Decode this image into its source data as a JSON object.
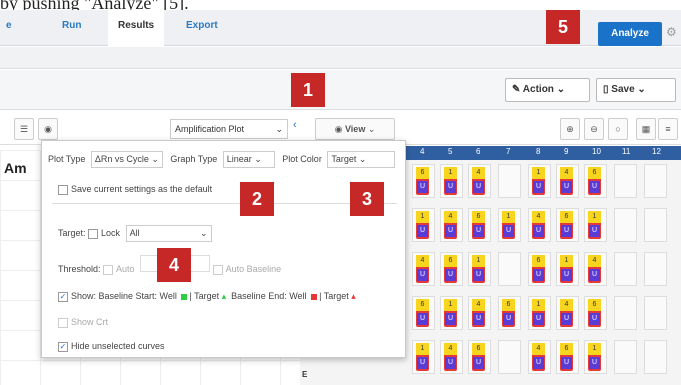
{
  "caption": "by pushing \"Analyze\" [5].",
  "tabs": [
    "e",
    "Run",
    "Results",
    "Export"
  ],
  "active_tab": "Results",
  "analyze_label": "Analyze",
  "action_label": "Action",
  "save_label": "Save",
  "plot_select": "Amplification Plot",
  "view_label": "View",
  "left_title": "Am",
  "popover": {
    "plot_type_label": "Plot Type",
    "plot_type_value": "ΔRn vs Cycle",
    "graph_type_label": "Graph Type",
    "graph_type_value": "Linear",
    "plot_color_label": "Plot Color",
    "plot_color_value": "Target",
    "save_default": "Save current settings as the default",
    "target_label": "Target:",
    "lock_label": "Lock",
    "target_value": "All",
    "threshold_label": "Threshold:",
    "auto_label": "Auto",
    "auto_baseline_label": "Auto Baseline",
    "show_baseline": "Show: Baseline Start: Well",
    "target_word": "Target",
    "baseline_end": "Baseline End: Well",
    "target_word2": "Target",
    "show_crt": "Show Crt",
    "hide_unselected": "Hide unselected curves"
  },
  "badges": [
    "1",
    "2",
    "3",
    "4",
    "5"
  ],
  "plate": {
    "columns": [
      "4",
      "5",
      "6",
      "7",
      "8",
      "9",
      "10",
      "11",
      "12"
    ],
    "row_labels": [
      "E"
    ],
    "well_marks": [
      "6",
      "1",
      "4",
      "U"
    ]
  },
  "colors": {
    "accent": "#1a73c9",
    "badge": "#c62828",
    "plate_header": "#2f5fa0"
  }
}
